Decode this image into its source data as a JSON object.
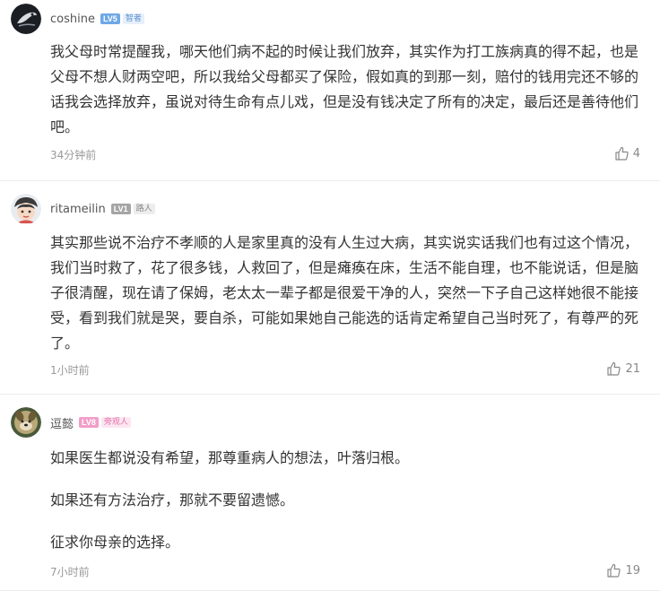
{
  "comments": [
    {
      "username": "coshine",
      "level": "LV5",
      "tag": "智者",
      "text": "我父母时常提醒我，哪天他们病不起的时候让我们放弃，其实作为打工族病真的得不起，也是父母不想人财两空吧，所以我给父母都买了保险，假如真的到那一刻，赔付的钱用完还不够的话我会选择放弃，虽说对待生命有点儿戏，但是没有钱决定了所有的决定，最后还是善待他们吧。",
      "time": "34分钟前",
      "likes": "4"
    },
    {
      "username": "ritameilin",
      "level": "LV1",
      "tag": "路人",
      "text": "其实那些说不治疗不孝顺的人是家里真的没有人生过大病，其实说实话我们也有过这个情况，我们当时救了，花了很多钱，人救回了，但是瘫痪在床，生活不能自理，也不能说话，但是脑子很清醒，现在请了保姆，老太太一辈子都是很爱干净的人，突然一下子自己这样她很不能接受，看到我们就是哭，要自杀，可能如果她自己能选的话肯定希望自己当时死了，有尊严的死了。",
      "time": "1小时前",
      "likes": "21"
    },
    {
      "username": "逗懿",
      "level": "LV8",
      "tag": "旁观人",
      "paragraphs": [
        "如果医生都说没有希望，那尊重病人的想法，叶落归根。",
        "如果还有方法治疗，那就不要留遗憾。",
        "征求你母亲的选择。"
      ],
      "time": "7小时前",
      "likes": "19"
    }
  ],
  "colors": {
    "lv5": "#6ea8e6",
    "lv1": "#a5a5a5",
    "lv8": "#f29ec8",
    "tag_zhizhe_bg": "#e6f0fb",
    "tag_zhizhe_text": "#5a8fd0",
    "tag_luren_bg": "#ededed",
    "tag_luren_text": "#888888",
    "tag_pangguan_bg": "#fde6f1",
    "tag_pangguan_text": "#e374aa"
  },
  "icons": {
    "avatar1": "dark-bird-avatar-icon",
    "avatar2": "cartoon-face-avatar-icon",
    "avatar3": "dog-avatar-icon",
    "like": "thumbs-up-icon"
  }
}
